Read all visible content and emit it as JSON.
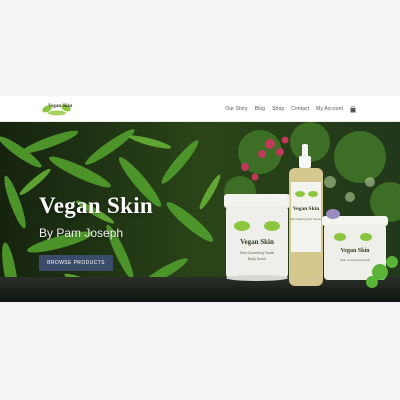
{
  "brand": {
    "logo_text": "Vegan Skin"
  },
  "nav": {
    "items": [
      "Our Story",
      "Blog",
      "Shop",
      "Contact",
      "My Account"
    ],
    "cart_icon": "shopping-bag-icon"
  },
  "hero": {
    "title": "Vegan Skin",
    "subtitle": "By Pam Joseph",
    "cta_label": "BROWSE PRODUCTS"
  },
  "products": {
    "jar_brand": "Vegan Skin",
    "jar_line1": "Skin Correcting Facial",
    "jar_line2": "Body Scrub",
    "bottle_brand": "Vegan Skin",
    "bottle_line1": "Skin Healing Face Serum",
    "small_jar_brand": "Vegan Skin",
    "small_jar_line1": "Skin Correcting Facial"
  },
  "colors": {
    "button": "#3b4c6b",
    "foliage": "#3f7a2a",
    "flowers": "#c0395a"
  }
}
